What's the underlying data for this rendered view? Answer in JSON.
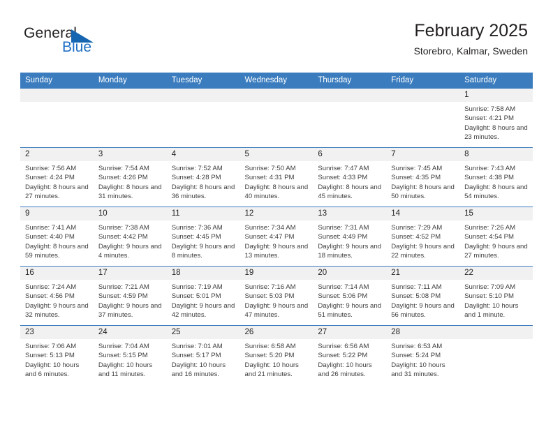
{
  "brand": {
    "name_part1": "General",
    "name_part2": "Blue",
    "accent_color": "#1565b0"
  },
  "header": {
    "title": "February 2025",
    "subtitle": "Storebro, Kalmar, Sweden"
  },
  "theme": {
    "header_row_color": "#3a7cbe",
    "daynum_strip_color": "#f1f1f1",
    "text_color": "#231f20"
  },
  "weekday_headers": [
    "Sunday",
    "Monday",
    "Tuesday",
    "Wednesday",
    "Thursday",
    "Friday",
    "Saturday"
  ],
  "weeks": [
    [
      {
        "day": "",
        "sunrise": "",
        "sunset": "",
        "daylight": "",
        "blank": true
      },
      {
        "day": "",
        "sunrise": "",
        "sunset": "",
        "daylight": "",
        "blank": true
      },
      {
        "day": "",
        "sunrise": "",
        "sunset": "",
        "daylight": "",
        "blank": true
      },
      {
        "day": "",
        "sunrise": "",
        "sunset": "",
        "daylight": "",
        "blank": true
      },
      {
        "day": "",
        "sunrise": "",
        "sunset": "",
        "daylight": "",
        "blank": true
      },
      {
        "day": "",
        "sunrise": "",
        "sunset": "",
        "daylight": "",
        "blank": true
      },
      {
        "day": "1",
        "sunrise": "Sunrise: 7:58 AM",
        "sunset": "Sunset: 4:21 PM",
        "daylight": "Daylight: 8 hours and 23 minutes."
      }
    ],
    [
      {
        "day": "2",
        "sunrise": "Sunrise: 7:56 AM",
        "sunset": "Sunset: 4:24 PM",
        "daylight": "Daylight: 8 hours and 27 minutes."
      },
      {
        "day": "3",
        "sunrise": "Sunrise: 7:54 AM",
        "sunset": "Sunset: 4:26 PM",
        "daylight": "Daylight: 8 hours and 31 minutes."
      },
      {
        "day": "4",
        "sunrise": "Sunrise: 7:52 AM",
        "sunset": "Sunset: 4:28 PM",
        "daylight": "Daylight: 8 hours and 36 minutes."
      },
      {
        "day": "5",
        "sunrise": "Sunrise: 7:50 AM",
        "sunset": "Sunset: 4:31 PM",
        "daylight": "Daylight: 8 hours and 40 minutes."
      },
      {
        "day": "6",
        "sunrise": "Sunrise: 7:47 AM",
        "sunset": "Sunset: 4:33 PM",
        "daylight": "Daylight: 8 hours and 45 minutes."
      },
      {
        "day": "7",
        "sunrise": "Sunrise: 7:45 AM",
        "sunset": "Sunset: 4:35 PM",
        "daylight": "Daylight: 8 hours and 50 minutes."
      },
      {
        "day": "8",
        "sunrise": "Sunrise: 7:43 AM",
        "sunset": "Sunset: 4:38 PM",
        "daylight": "Daylight: 8 hours and 54 minutes."
      }
    ],
    [
      {
        "day": "9",
        "sunrise": "Sunrise: 7:41 AM",
        "sunset": "Sunset: 4:40 PM",
        "daylight": "Daylight: 8 hours and 59 minutes."
      },
      {
        "day": "10",
        "sunrise": "Sunrise: 7:38 AM",
        "sunset": "Sunset: 4:42 PM",
        "daylight": "Daylight: 9 hours and 4 minutes."
      },
      {
        "day": "11",
        "sunrise": "Sunrise: 7:36 AM",
        "sunset": "Sunset: 4:45 PM",
        "daylight": "Daylight: 9 hours and 8 minutes."
      },
      {
        "day": "12",
        "sunrise": "Sunrise: 7:34 AM",
        "sunset": "Sunset: 4:47 PM",
        "daylight": "Daylight: 9 hours and 13 minutes."
      },
      {
        "day": "13",
        "sunrise": "Sunrise: 7:31 AM",
        "sunset": "Sunset: 4:49 PM",
        "daylight": "Daylight: 9 hours and 18 minutes."
      },
      {
        "day": "14",
        "sunrise": "Sunrise: 7:29 AM",
        "sunset": "Sunset: 4:52 PM",
        "daylight": "Daylight: 9 hours and 22 minutes."
      },
      {
        "day": "15",
        "sunrise": "Sunrise: 7:26 AM",
        "sunset": "Sunset: 4:54 PM",
        "daylight": "Daylight: 9 hours and 27 minutes."
      }
    ],
    [
      {
        "day": "16",
        "sunrise": "Sunrise: 7:24 AM",
        "sunset": "Sunset: 4:56 PM",
        "daylight": "Daylight: 9 hours and 32 minutes."
      },
      {
        "day": "17",
        "sunrise": "Sunrise: 7:21 AM",
        "sunset": "Sunset: 4:59 PM",
        "daylight": "Daylight: 9 hours and 37 minutes."
      },
      {
        "day": "18",
        "sunrise": "Sunrise: 7:19 AM",
        "sunset": "Sunset: 5:01 PM",
        "daylight": "Daylight: 9 hours and 42 minutes."
      },
      {
        "day": "19",
        "sunrise": "Sunrise: 7:16 AM",
        "sunset": "Sunset: 5:03 PM",
        "daylight": "Daylight: 9 hours and 47 minutes."
      },
      {
        "day": "20",
        "sunrise": "Sunrise: 7:14 AM",
        "sunset": "Sunset: 5:06 PM",
        "daylight": "Daylight: 9 hours and 51 minutes."
      },
      {
        "day": "21",
        "sunrise": "Sunrise: 7:11 AM",
        "sunset": "Sunset: 5:08 PM",
        "daylight": "Daylight: 9 hours and 56 minutes."
      },
      {
        "day": "22",
        "sunrise": "Sunrise: 7:09 AM",
        "sunset": "Sunset: 5:10 PM",
        "daylight": "Daylight: 10 hours and 1 minute."
      }
    ],
    [
      {
        "day": "23",
        "sunrise": "Sunrise: 7:06 AM",
        "sunset": "Sunset: 5:13 PM",
        "daylight": "Daylight: 10 hours and 6 minutes."
      },
      {
        "day": "24",
        "sunrise": "Sunrise: 7:04 AM",
        "sunset": "Sunset: 5:15 PM",
        "daylight": "Daylight: 10 hours and 11 minutes."
      },
      {
        "day": "25",
        "sunrise": "Sunrise: 7:01 AM",
        "sunset": "Sunset: 5:17 PM",
        "daylight": "Daylight: 10 hours and 16 minutes."
      },
      {
        "day": "26",
        "sunrise": "Sunrise: 6:58 AM",
        "sunset": "Sunset: 5:20 PM",
        "daylight": "Daylight: 10 hours and 21 minutes."
      },
      {
        "day": "27",
        "sunrise": "Sunrise: 6:56 AM",
        "sunset": "Sunset: 5:22 PM",
        "daylight": "Daylight: 10 hours and 26 minutes."
      },
      {
        "day": "28",
        "sunrise": "Sunrise: 6:53 AM",
        "sunset": "Sunset: 5:24 PM",
        "daylight": "Daylight: 10 hours and 31 minutes."
      },
      {
        "day": "",
        "sunrise": "",
        "sunset": "",
        "daylight": "",
        "blank": true
      }
    ]
  ]
}
